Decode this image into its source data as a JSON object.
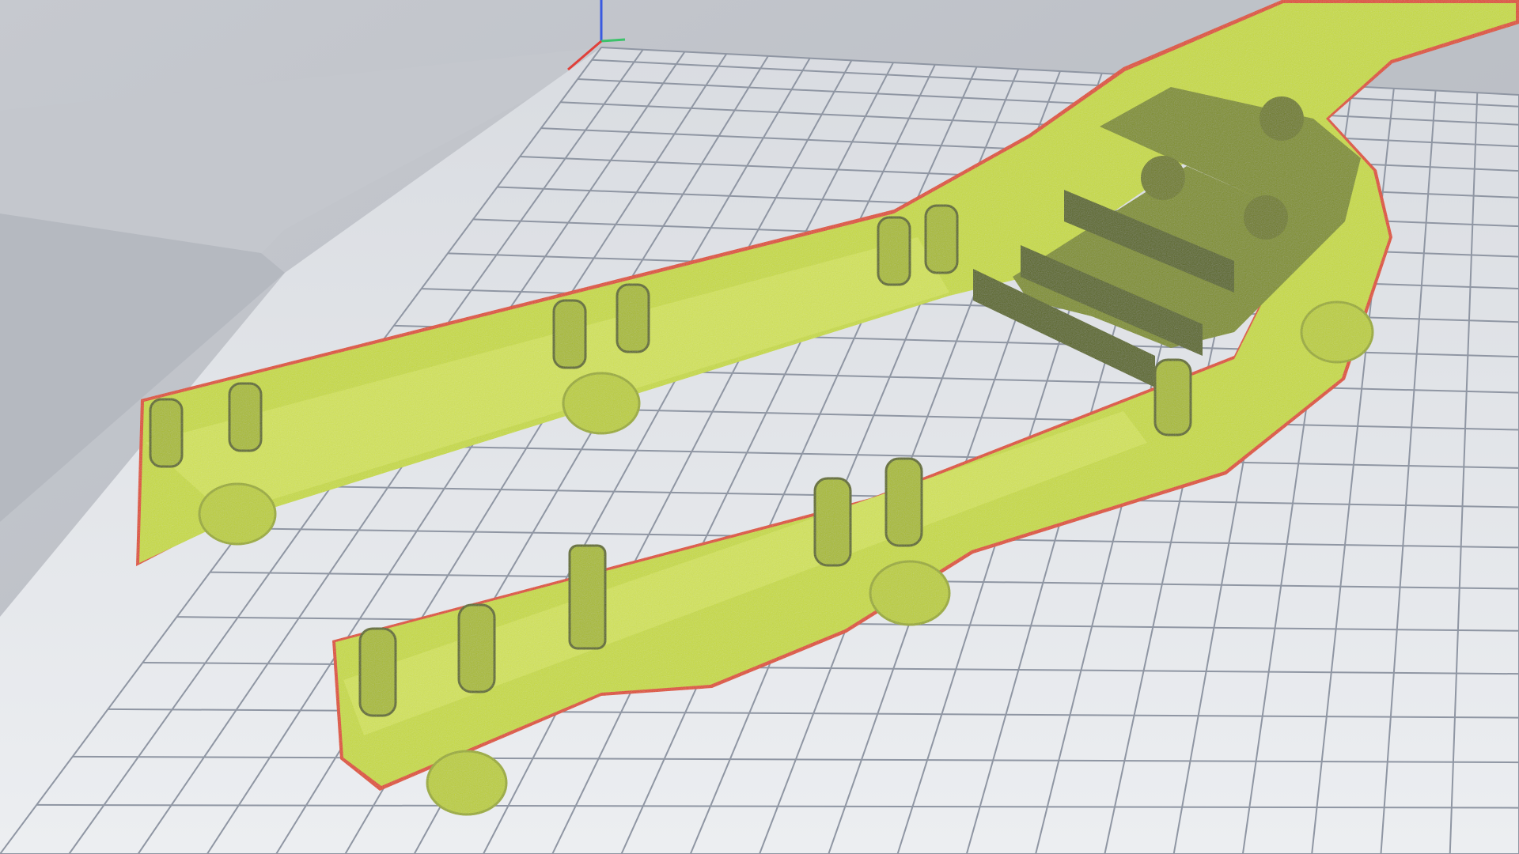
{
  "viewport": {
    "mode": "3d-perspective",
    "background_color": "#c9ccd2",
    "bed_color": "#e6e8ec",
    "grid_line_color": "#8f96a3",
    "model_color": "#c8dc3a",
    "model_shadow_color": "#7f8f1c",
    "model_outline_color": "#e04a2a",
    "axes": {
      "x_color": "#e0403a",
      "y_color": "#3cc26a",
      "z_color": "#3a5ae0"
    }
  },
  "model": {
    "icon": "3d-part-model"
  }
}
